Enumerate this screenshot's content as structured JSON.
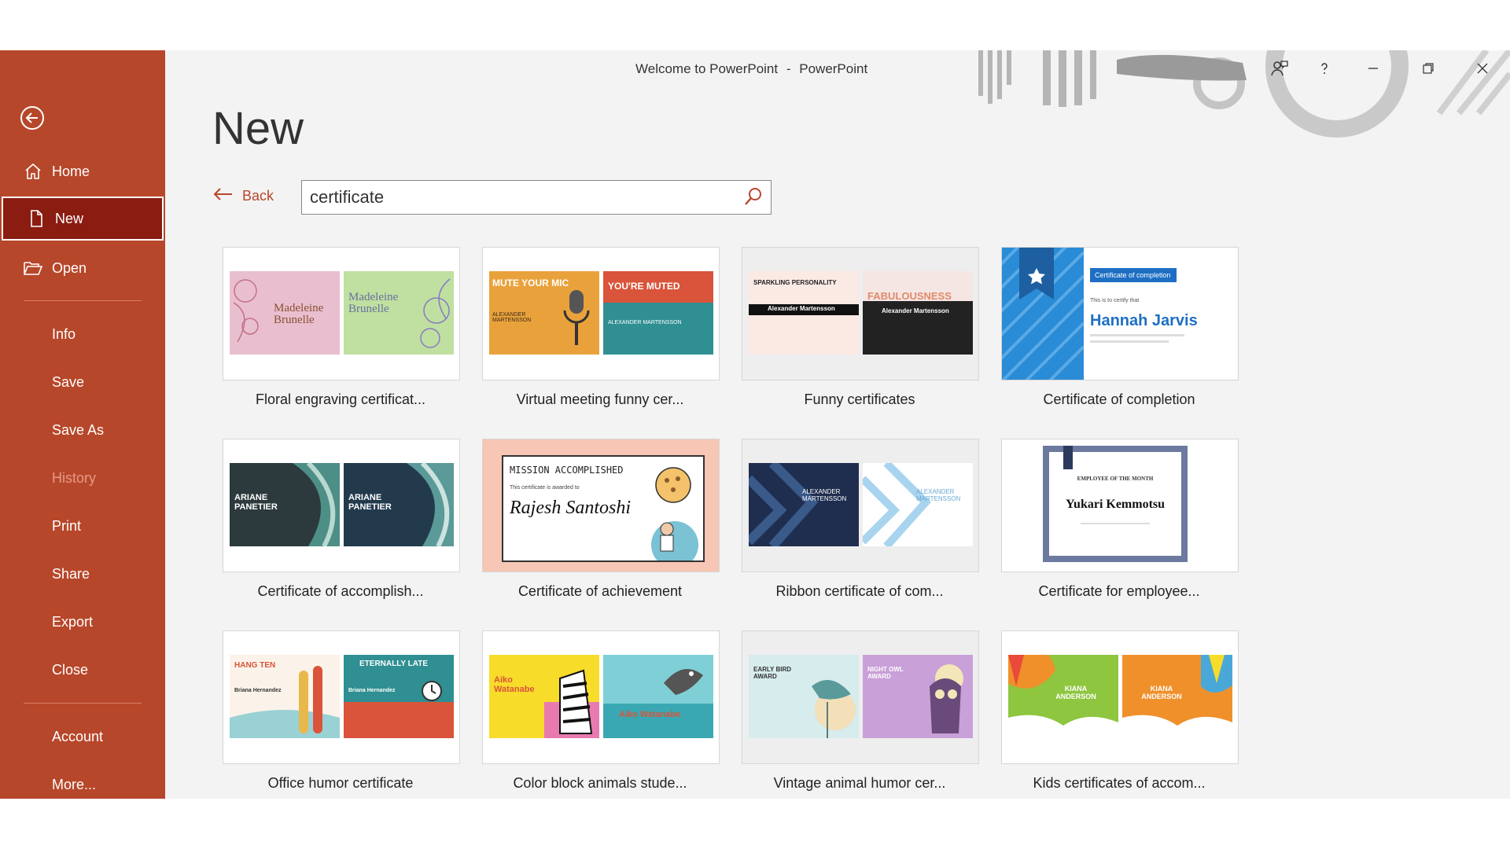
{
  "window": {
    "title": "Welcome to PowerPoint",
    "separator": "-",
    "app_name": "PowerPoint"
  },
  "sidebar": {
    "back_icon": "back-arrow-circle-icon",
    "items": [
      {
        "label": "Home",
        "icon": "home-icon",
        "state": "normal"
      },
      {
        "label": "New",
        "icon": "new-document-icon",
        "state": "active"
      },
      {
        "label": "Open",
        "icon": "open-folder-icon",
        "state": "normal"
      },
      {
        "label": "Info",
        "state": "normal"
      },
      {
        "label": "Save",
        "state": "normal"
      },
      {
        "label": "Save As",
        "state": "normal"
      },
      {
        "label": "History",
        "state": "disabled"
      },
      {
        "label": "Print",
        "state": "normal"
      },
      {
        "label": "Share",
        "state": "normal"
      },
      {
        "label": "Export",
        "state": "normal"
      },
      {
        "label": "Close",
        "state": "normal"
      },
      {
        "label": "Account",
        "state": "normal"
      },
      {
        "label": "More...",
        "state": "normal"
      }
    ]
  },
  "page": {
    "title": "New",
    "back_label": "Back"
  },
  "search": {
    "value": "certificate",
    "placeholder": ""
  },
  "thumb_text": {
    "floral_a": "Madeleine Brunelle",
    "floral_b": "Madeleine Brunelle",
    "meeting_a": "MUTE YOUR MIC",
    "meeting_a_name": "ALEXANDER MARTENSSON",
    "meeting_b": "YOU'RE MUTED",
    "meeting_b_name": "ALEXANDER MARTENSSON",
    "funny_a": "SPARKLING PERSONALITY",
    "funny_a_name": "Alexander Martensson",
    "funny_b": "FABULOUSNESS",
    "funny_b_name": "Alexander Martensson",
    "completion_badge": "Certificate of completion",
    "completion_intro": "This is to certify that",
    "completion_name": "Hannah Jarvis",
    "accomplish_a": "ARIANE PANETIER",
    "accomplish_b": "ARIANE PANETIER",
    "achieve_head": "MISSION ACCOMPLISHED",
    "achieve_sub": "This certificate is awarded to",
    "achieve_name": "Rajesh Santoshi",
    "ribbon_a": "ALEXANDER MARTENSSON",
    "ribbon_b": "ALEXANDER MARTENSSON",
    "employee_head": "EMPLOYEE OF THE MONTH",
    "employee_name": "Yukari Kemmotsu",
    "office_a": "HANG TEN",
    "office_a_name": "Briana Hernandez",
    "office_b": "ETERNALLY LATE",
    "office_b_name": "Briana Hernandez",
    "animals_a": "Aiko Watanabe",
    "animals_b": "Aiko Watanabe",
    "vintage_a": "EARLY BIRD AWARD",
    "vintage_b": "NIGHT OWL AWARD",
    "kids_a": "KIANA ANDERSON",
    "kids_b": "KIANA ANDERSON"
  },
  "templates": [
    {
      "label": "Floral engraving certificat..."
    },
    {
      "label": "Virtual meeting funny cer..."
    },
    {
      "label": "Funny certificates"
    },
    {
      "label": "Certificate of completion"
    },
    {
      "label": "Certificate of accomplish..."
    },
    {
      "label": "Certificate of achievement"
    },
    {
      "label": "Ribbon certificate of com..."
    },
    {
      "label": "Certificate for employee..."
    },
    {
      "label": "Office humor certificate"
    },
    {
      "label": "Color block animals stude..."
    },
    {
      "label": "Vintage animal humor cer..."
    },
    {
      "label": "Kids certificates of accom..."
    }
  ],
  "colors": {
    "sidebar": "#b7472a",
    "sidebar_active": "#8a1c12",
    "accent": "#b7472a",
    "background": "#f3f3f3"
  }
}
